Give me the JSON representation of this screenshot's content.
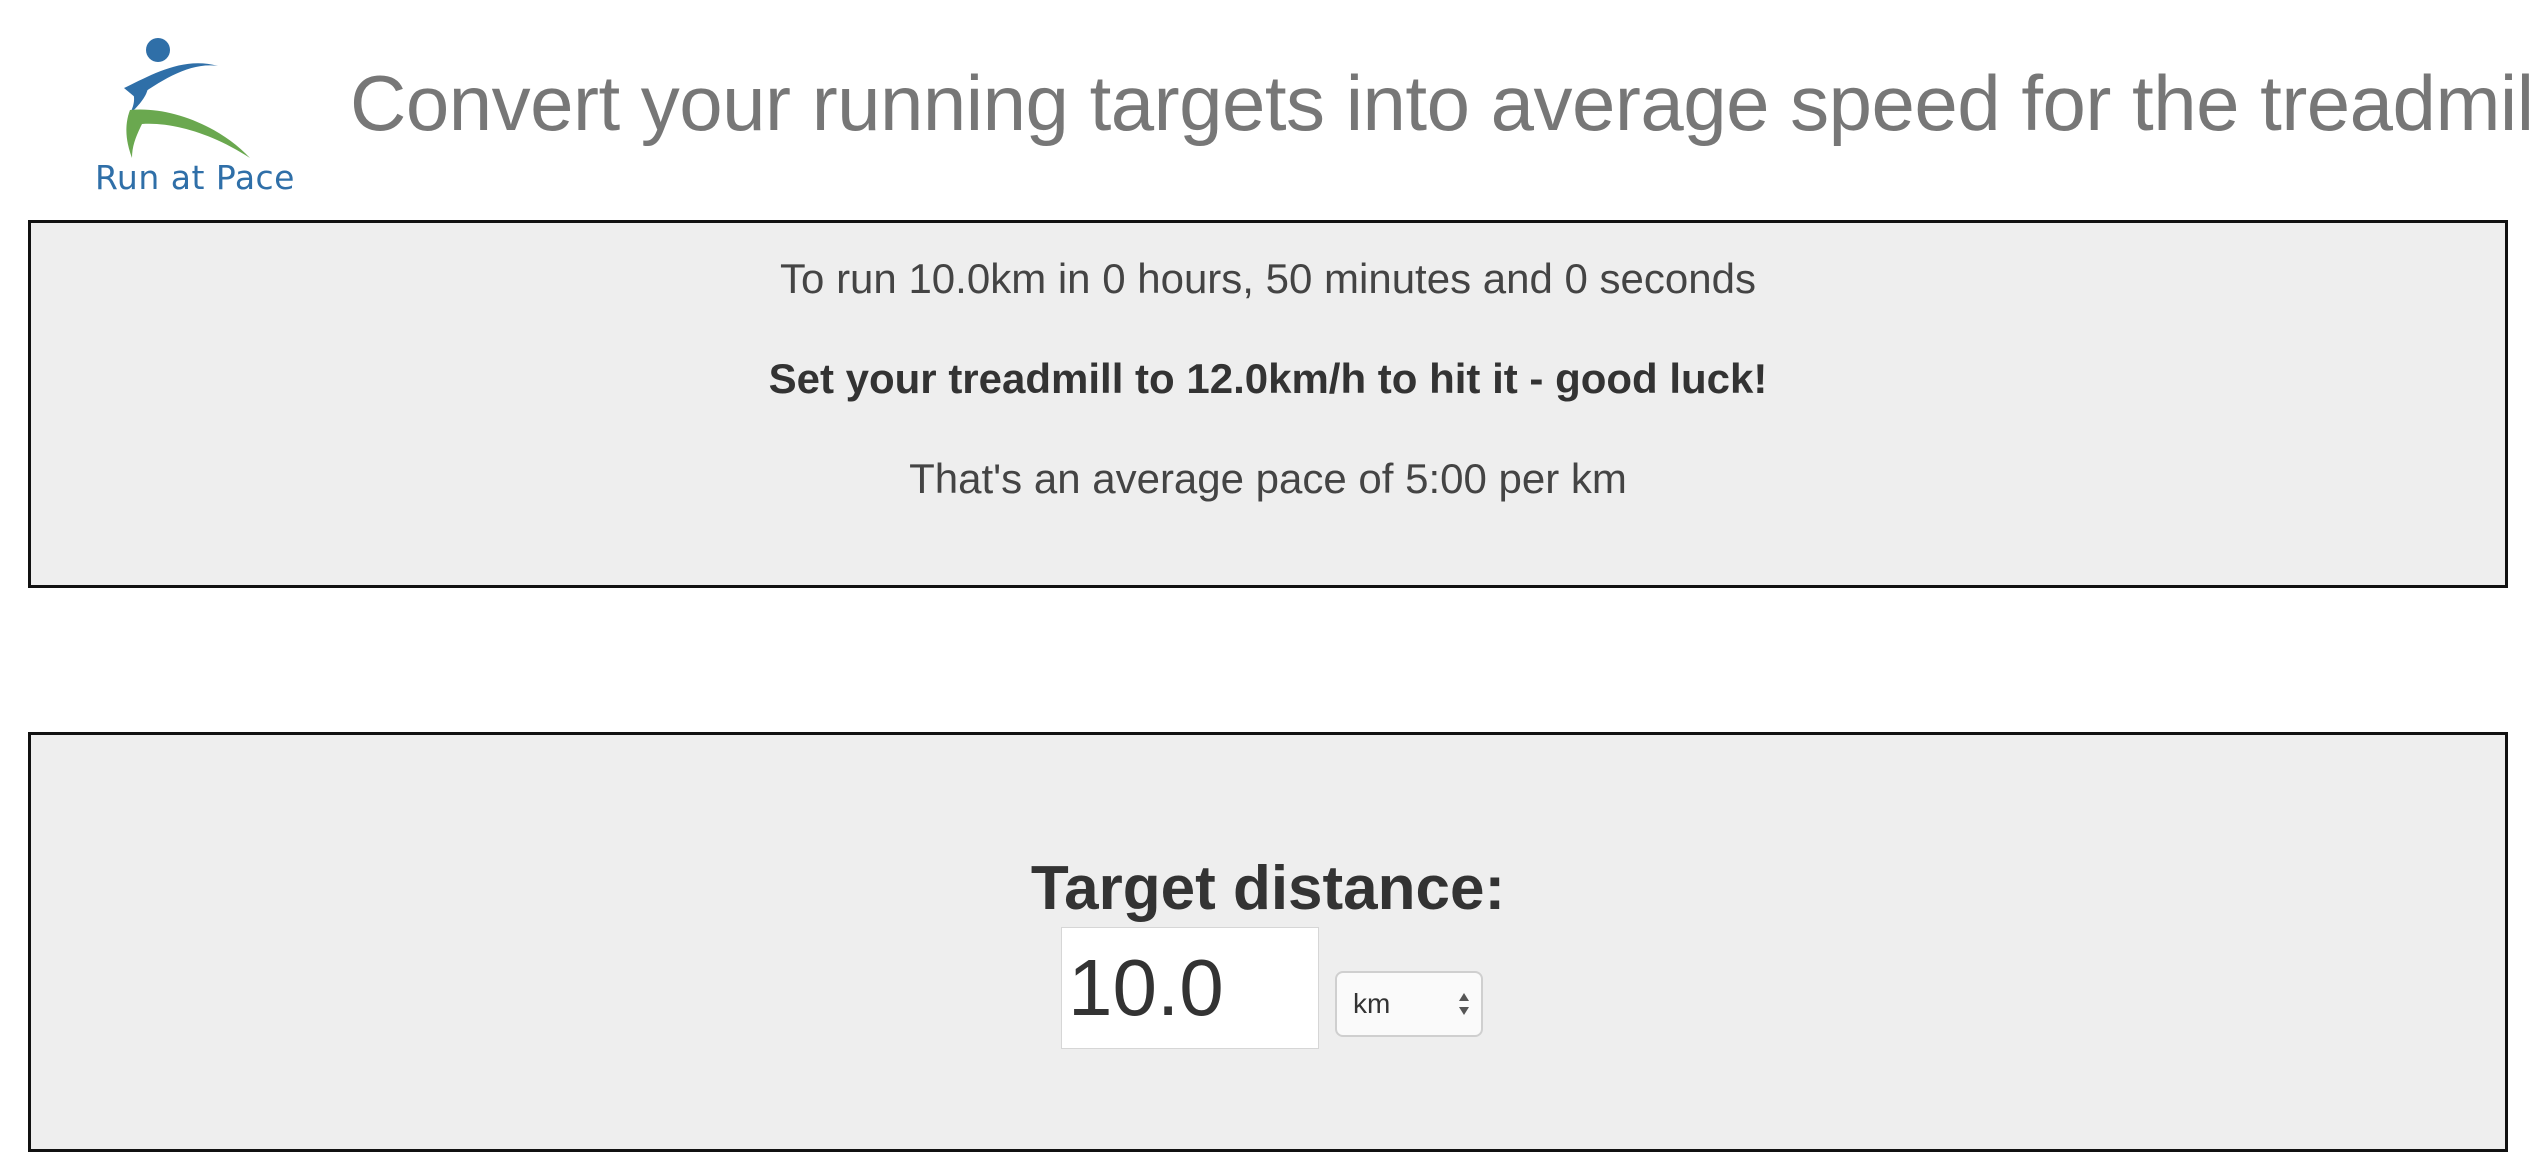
{
  "brand": {
    "name": "Run at Pace",
    "colors": {
      "blue": "#2f6fa8",
      "green": "#6aa84f"
    }
  },
  "header": {
    "title": "Convert your running targets into average speed for the treadmill"
  },
  "result": {
    "summary": "To run 10.0km in 0 hours, 50 minutes and 0 seconds",
    "speed_advice": "Set your treadmill to 12.0km/h to hit it - good luck!",
    "pace": "That's an average pace of 5:00 per km"
  },
  "form": {
    "target_distance_label": "Target distance:",
    "distance_value": "10.0",
    "unit_selected": "km"
  }
}
